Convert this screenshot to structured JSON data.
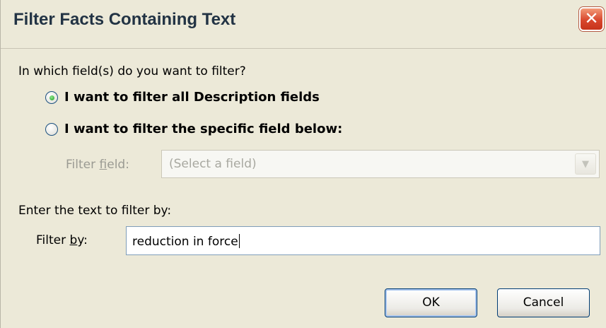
{
  "window": {
    "title": "Filter Facts Containing Text",
    "close_glyph": "✕"
  },
  "filter_scope": {
    "question": "In which field(s) do you want to filter?",
    "options": [
      {
        "label": "I want to filter all Description fields",
        "checked": true
      },
      {
        "label": "I want to filter the specific field below:",
        "checked": false
      }
    ]
  },
  "filter_field": {
    "label_prefix": "Filter ",
    "label_accel": "f",
    "label_suffix": "ield:",
    "selected_value": "(Select a field)",
    "enabled": false,
    "arrow_glyph": "▼"
  },
  "filter_text": {
    "prompt": "Enter the text to filter by:",
    "label_prefix": "Filter ",
    "label_accel": "b",
    "label_suffix": "y:",
    "value": "reduction in force"
  },
  "buttons": {
    "ok": "OK",
    "cancel": "Cancel"
  },
  "colors": {
    "dialog_bg": "#ece9d8",
    "close_button": "#d8472d",
    "disabled_text": "#9b9b93",
    "input_border": "#7f9db9",
    "button_border": "#003c74"
  }
}
